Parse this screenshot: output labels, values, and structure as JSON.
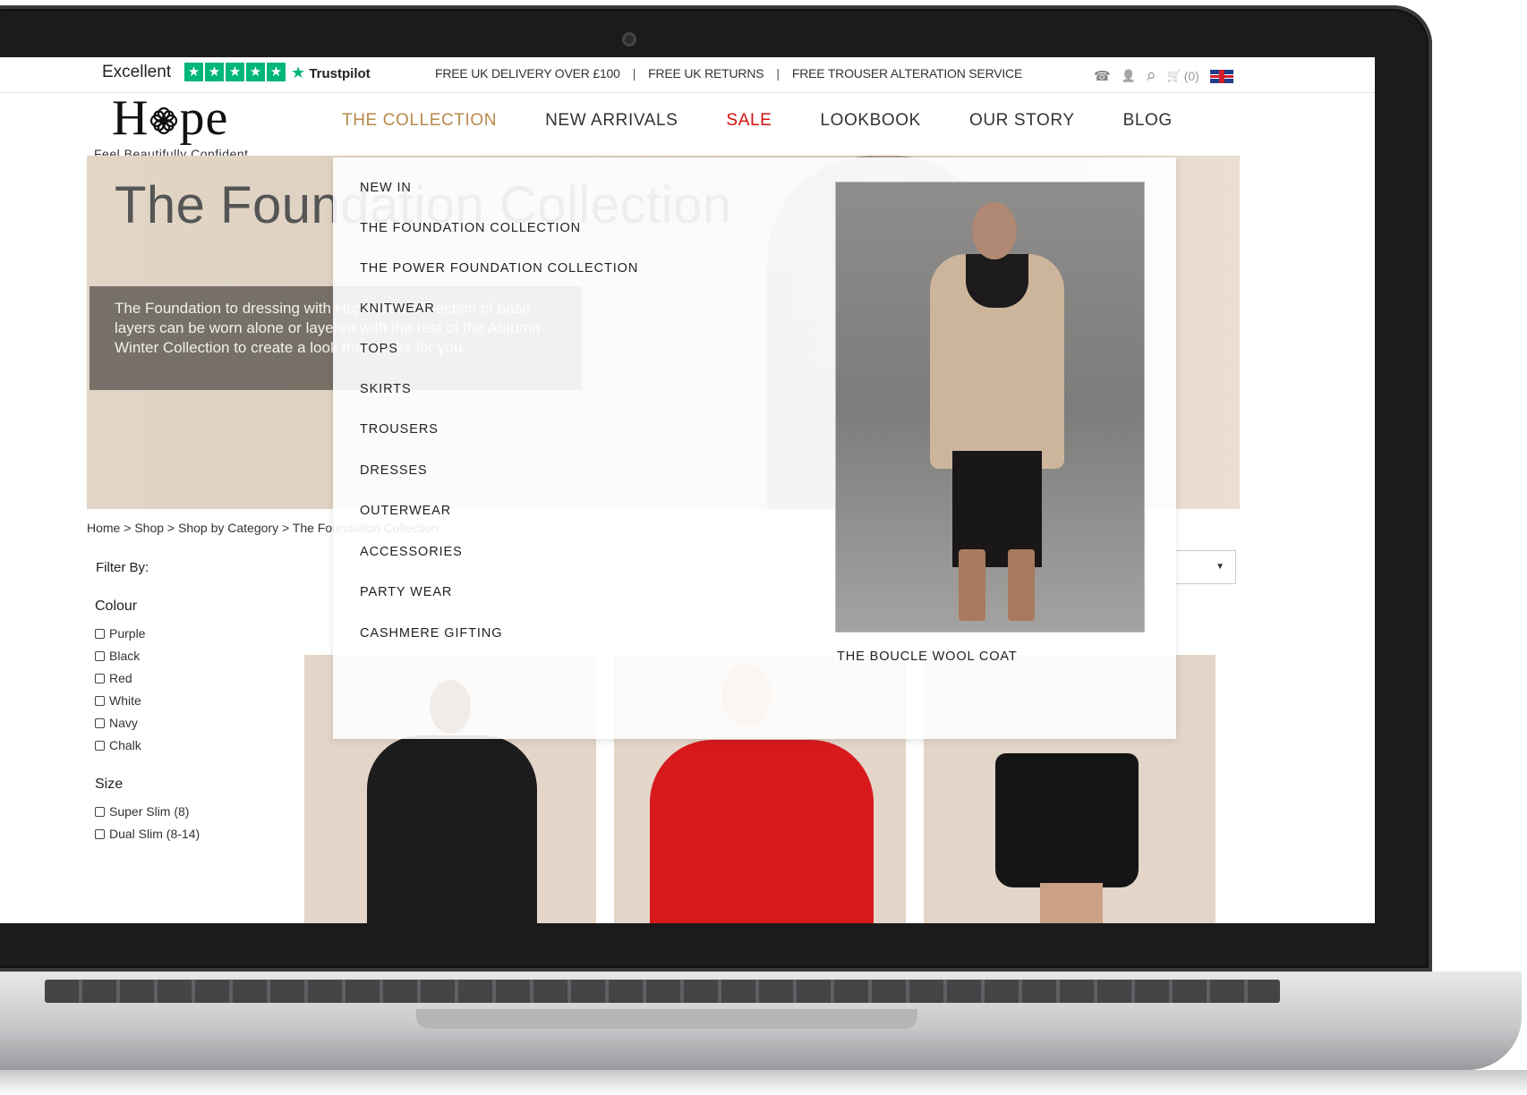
{
  "trustpilot": {
    "rating_word": "Excellent",
    "brand": "Trustpilot",
    "stars": 5,
    "star_glyph": "★",
    "brand_glyph": "★",
    "color": "#00b67a"
  },
  "promos": [
    "FREE UK DELIVERY OVER £100",
    "FREE UK RETURNS",
    "FREE TROUSER ALTERATION SERVICE"
  ],
  "promo_separator": "|",
  "utility": {
    "phone_icon": "phone-icon",
    "phone_glyph": "☎",
    "account_icon": "user-icon",
    "account_glyph": "👤",
    "search_icon": "search-icon",
    "search_glyph": "⌕",
    "cart_icon": "cart-icon",
    "cart_glyph": "🛒",
    "cart_count": "(0)",
    "flag_icon": "uk-flag-icon"
  },
  "logo": {
    "text_before": "H",
    "text_after": "pe",
    "tagline": "Feel Beautifully Confident"
  },
  "nav": [
    {
      "label": "THE COLLECTION",
      "state": "active"
    },
    {
      "label": "NEW ARRIVALS",
      "state": ""
    },
    {
      "label": "SALE",
      "state": "sale"
    },
    {
      "label": "LOOKBOOK",
      "state": ""
    },
    {
      "label": "OUR STORY",
      "state": ""
    },
    {
      "label": "BLOG",
      "state": ""
    }
  ],
  "colors": {
    "accent": "#b8894b",
    "sale": "#d10f0f"
  },
  "hero": {
    "title": "The Foundation Collection",
    "text": "The Foundation to dressing with Hope. This collection of base layers can be worn alone or layered with the rest of the Autumn Winter Collection to create a look that works for you."
  },
  "breadcrumb": [
    "Home",
    "Shop",
    "Shop by Category",
    "The Foundation Collection"
  ],
  "breadcrumb_separator": ">",
  "filters": {
    "title": "Filter By:",
    "groups": [
      {
        "name": "Colour",
        "options": [
          "Purple",
          "Black",
          "Red",
          "White",
          "Navy",
          "Chalk"
        ]
      },
      {
        "name": "Size",
        "options": [
          "Super Slim (8)",
          "Dual Slim (8-14)"
        ]
      }
    ]
  },
  "sort": {
    "caret": "▼"
  },
  "megamenu": {
    "items": [
      "NEW IN",
      "THE FOUNDATION COLLECTION",
      "THE POWER FOUNDATION COLLECTION",
      "KNITWEAR",
      "TOPS",
      "SKIRTS",
      "TROUSERS",
      "DRESSES",
      "OUTERWEAR",
      "ACCESSORIES",
      "PARTY WEAR",
      "CASHMERE GIFTING"
    ],
    "feature_caption": "THE BOUCLE WOOL COAT"
  }
}
